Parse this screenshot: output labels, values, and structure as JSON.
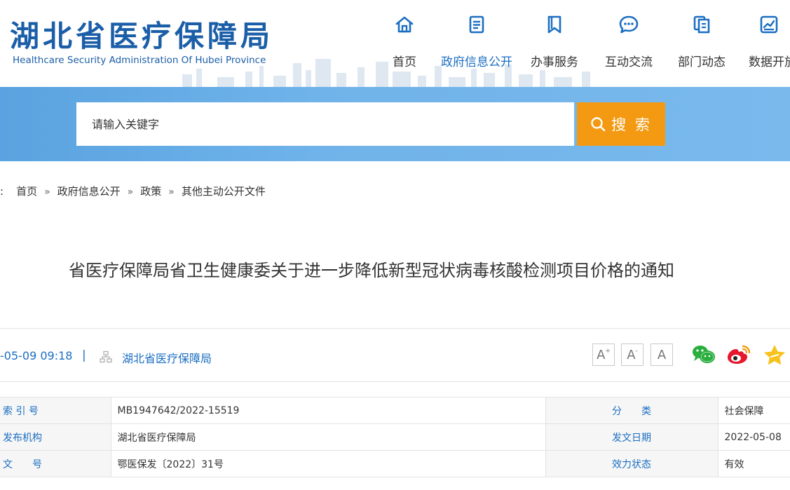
{
  "site": {
    "title_cn": "湖北省医疗保障局",
    "title_en": "Healthcare Security Administration Of Hubei Province"
  },
  "nav": [
    {
      "label": "首页",
      "icon": "home-icon",
      "active": false
    },
    {
      "label": "政府信息公开",
      "icon": "document-list-icon",
      "active": true
    },
    {
      "label": "办事服务",
      "icon": "bookmark-icon",
      "active": false
    },
    {
      "label": "互动交流",
      "icon": "chat-bubble-icon",
      "active": false
    },
    {
      "label": "部门动态",
      "icon": "copy-icon",
      "active": false
    },
    {
      "label": "数据开放",
      "icon": "chart-icon",
      "active": false
    }
  ],
  "search": {
    "placeholder": "请输入关键字",
    "button_label": "搜 索"
  },
  "breadcrumb": {
    "prefix": ":",
    "items": [
      "首页",
      "政府信息公开",
      "政策",
      "其他主动公开文件"
    ],
    "separator": "»"
  },
  "article": {
    "title": "省医疗保障局省卫生健康委关于进一步降低新型冠状病毒核酸检测项目价格的通知",
    "date": "-05-09 09:18",
    "divider": "|",
    "org": "湖北省医疗保障局"
  },
  "font_controls": [
    "A",
    "A",
    "A"
  ],
  "share": [
    "wechat-icon",
    "weibo-icon",
    "favorite-star-icon"
  ],
  "info_rows": [
    {
      "label1": "索 引 号",
      "value1": "MB1947642/2022-15519",
      "label2": "分　　类",
      "value2": "社会保障"
    },
    {
      "label1": "发布机构",
      "value1": "湖北省医疗保障局",
      "label2": "发文日期",
      "value2": "2022-05-08"
    },
    {
      "label1": "文　　号",
      "value1": "鄂医保发〔2022〕31号",
      "label2": "效力状态",
      "value2": "有效"
    }
  ],
  "colors": {
    "brand_blue": "#1b5ea8",
    "link_blue": "#1b6ec2",
    "search_band": "#6fb3ea",
    "search_button": "#f39a12"
  }
}
